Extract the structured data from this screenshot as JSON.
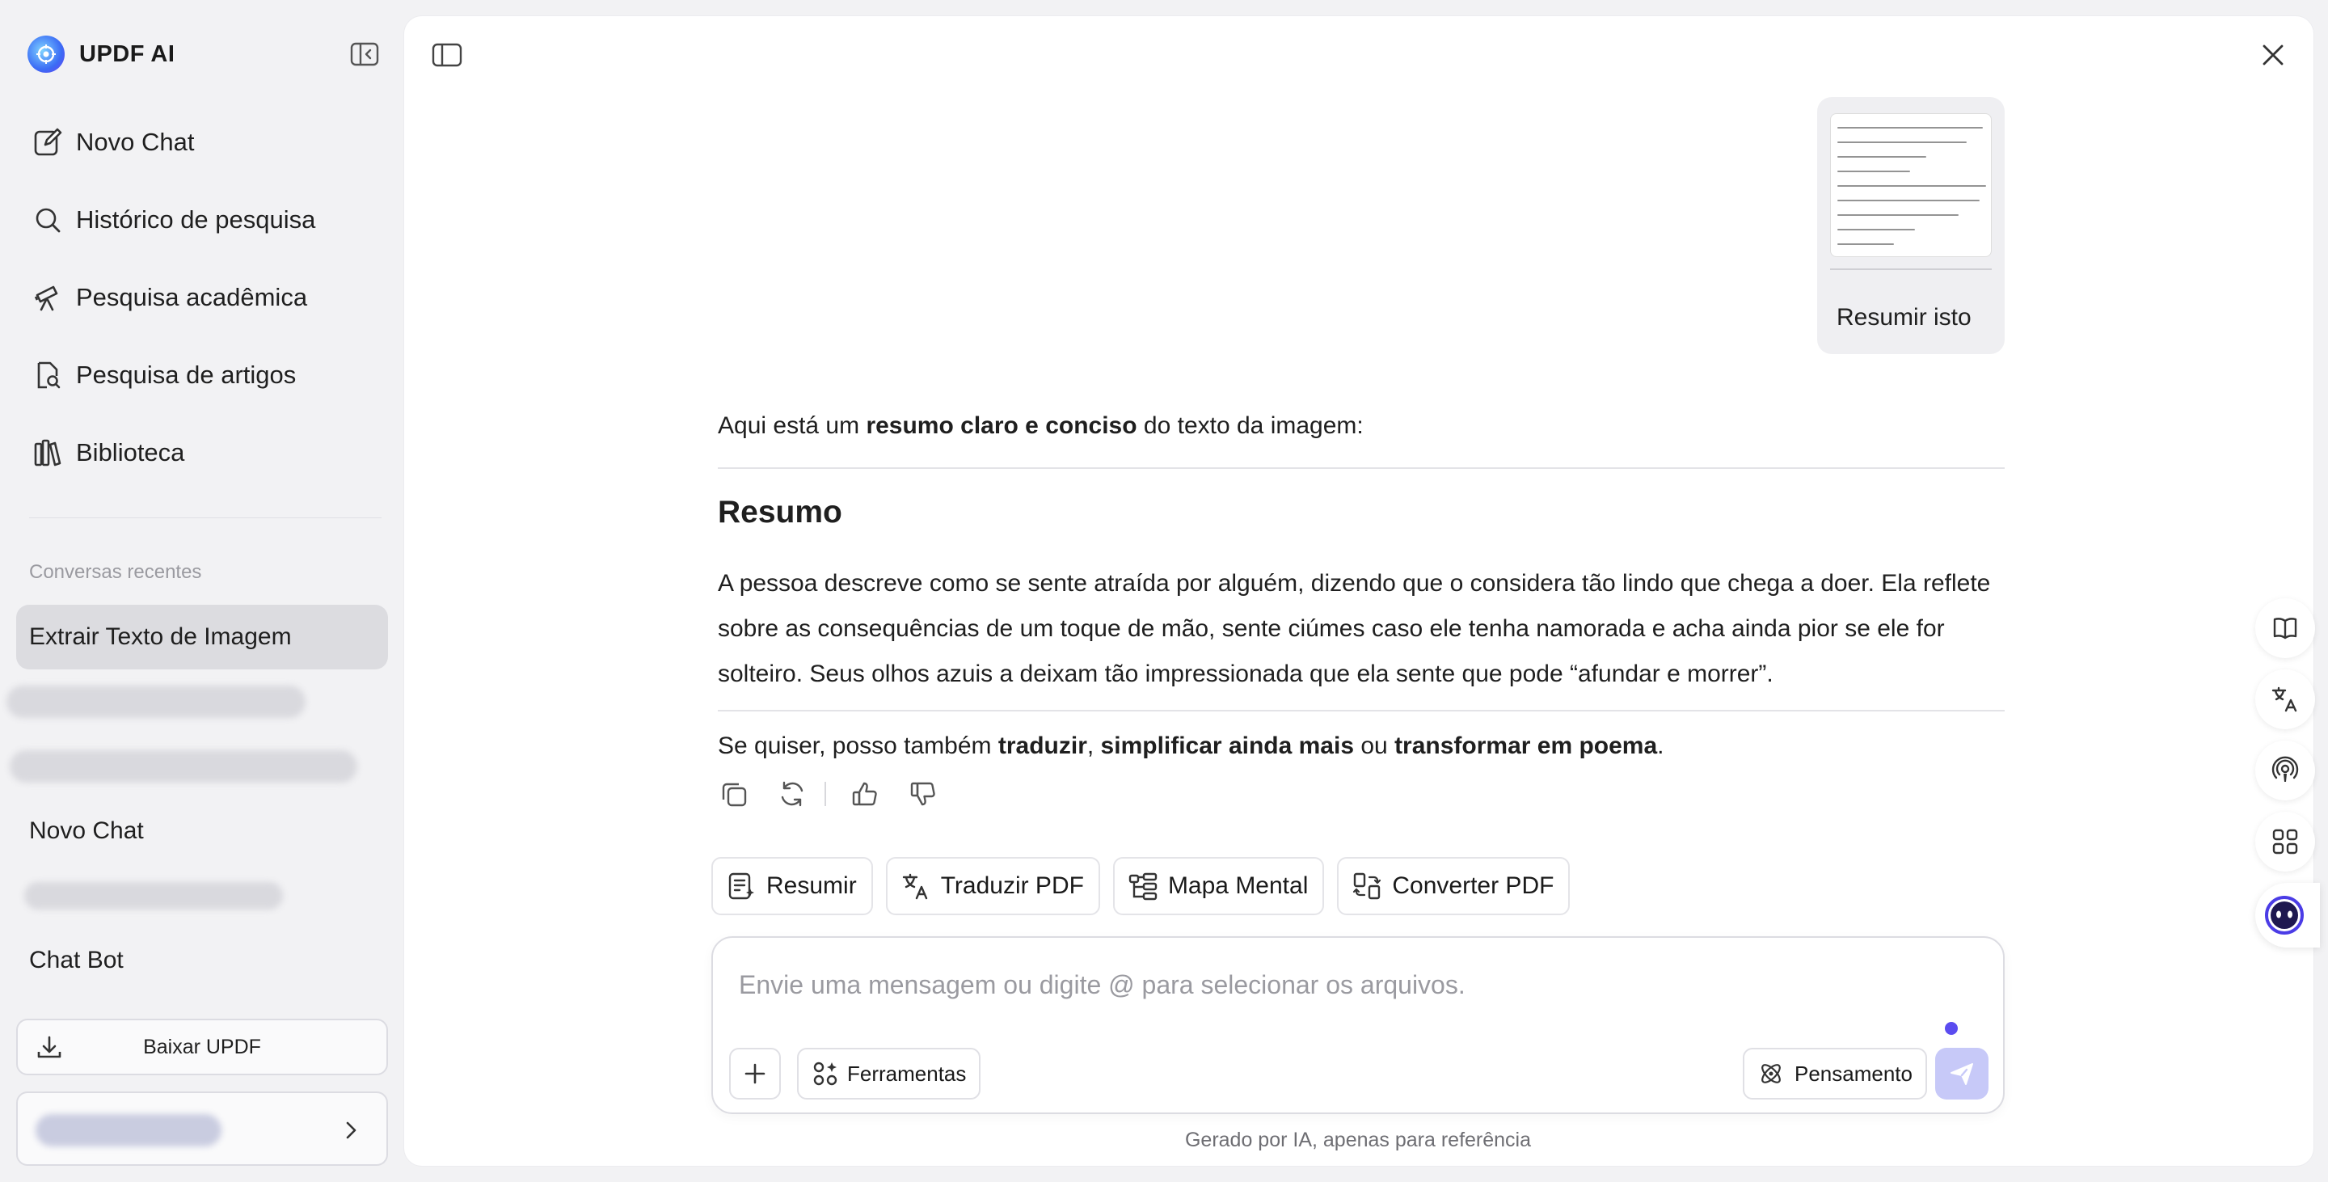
{
  "app": {
    "name": "UPDF AI"
  },
  "sidebar": {
    "nav": [
      {
        "label": "Novo Chat",
        "icon": "edit-icon"
      },
      {
        "label": "Histórico de pesquisa",
        "icon": "search-icon"
      },
      {
        "label": "Pesquisa acadêmica",
        "icon": "telescope-icon"
      },
      {
        "label": "Pesquisa de artigos",
        "icon": "document-search-icon"
      },
      {
        "label": "Biblioteca",
        "icon": "library-icon"
      }
    ],
    "recent_title": "Conversas recentes",
    "recent": [
      {
        "label": "Extrair Texto de Imagem"
      },
      {
        "label": "Novo Chat"
      },
      {
        "label": "Chat Bot"
      }
    ],
    "download_label": "Baixar UPDF"
  },
  "chat": {
    "user_message": "Resumir isto",
    "answer": {
      "intro_pre": "Aqui está um ",
      "intro_bold": "resumo claro e conciso",
      "intro_post": " do texto da imagem:",
      "heading": "Resumo",
      "paragraph": "A pessoa descreve como se sente atraída por alguém, dizendo que o considera tão lindo que chega a doer. Ela reflete sobre as consequências de um toque de mão, sente ciúmes caso ele tenha namorada e acha ainda pior se ele for solteiro. Seus olhos azuis a deixam tão impressionada que ela sente que pode “afundar e morrer”.",
      "closing_pre": "Se quiser, posso também ",
      "closing_b1": "traduzir",
      "closing_sep1": ", ",
      "closing_b2": "simplificar ainda mais",
      "closing_sep2": " ou ",
      "closing_b3": "transformar em poema",
      "closing_end": "."
    }
  },
  "quick_tools": [
    {
      "label": "Resumir"
    },
    {
      "label": "Traduzir PDF"
    },
    {
      "label": "Mapa Mental"
    },
    {
      "label": "Converter PDF"
    }
  ],
  "composer": {
    "placeholder": "Envie uma mensagem ou digite @ para selecionar os arquivos.",
    "value": "",
    "tools_label": "Ferramentas",
    "thinking_label": "Pensamento"
  },
  "disclaimer": "Gerado por IA, apenas para referência",
  "colors": {
    "accent": "#5b4cf0",
    "send_disabled": "#c7c9f8",
    "active_item": "#dcdce0"
  }
}
